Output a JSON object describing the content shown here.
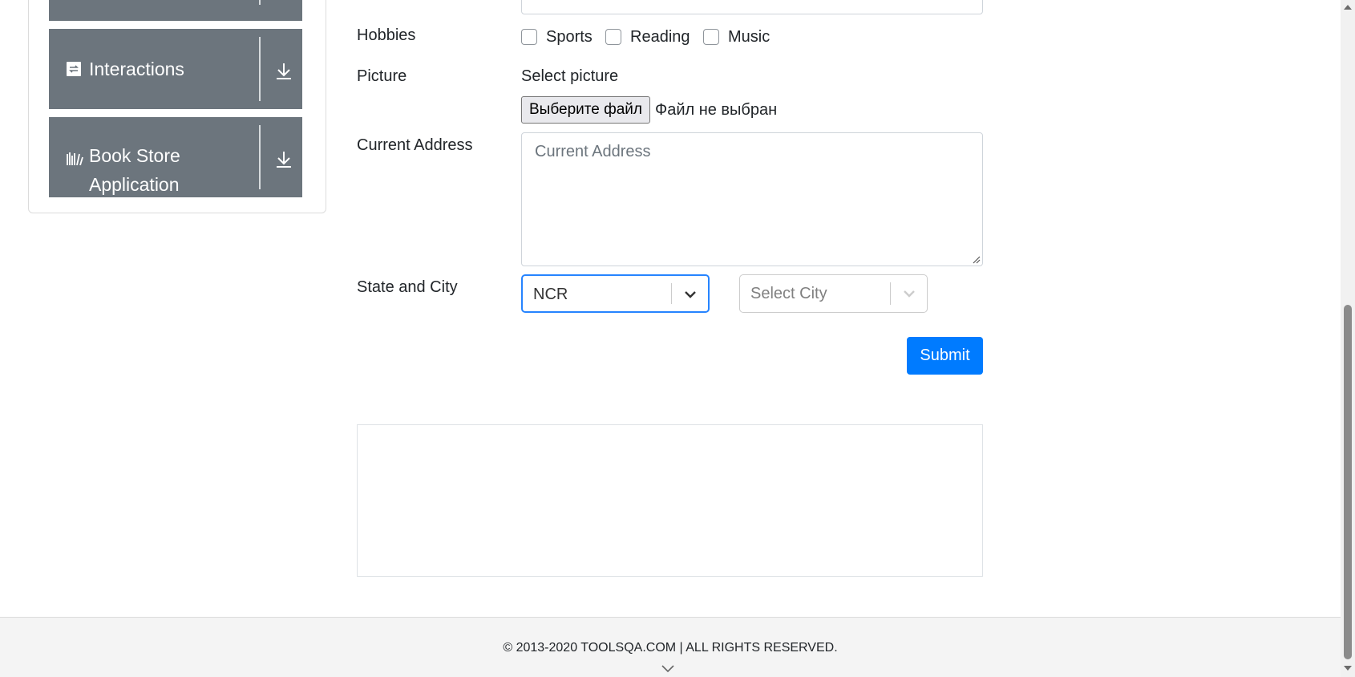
{
  "sidebar": {
    "groups": [
      {
        "label": "Interactions",
        "icon": "interactions-icon"
      },
      {
        "label": "Book Store Application",
        "icon": "book-store-icon"
      }
    ]
  },
  "form": {
    "hobbies_label": "Hobbies",
    "hobbies": [
      "Sports",
      "Reading",
      "Music"
    ],
    "picture_label": "Picture",
    "picture_hint": "Select picture",
    "file_button": "Выберите файл",
    "file_status": "Файл не выбран",
    "address_label": "Current Address",
    "address_placeholder": "Current Address",
    "state_city_label": "State and City",
    "state_value": "NCR",
    "city_placeholder": "Select City",
    "submit_label": "Submit"
  },
  "footer": {
    "text": "© 2013-2020 TOOLSQA.COM | ALL RIGHTS RESERVED."
  },
  "colors": {
    "sidebar_bg": "#6c757d",
    "accent": "#007bff",
    "focus_border": "#2684ff"
  }
}
